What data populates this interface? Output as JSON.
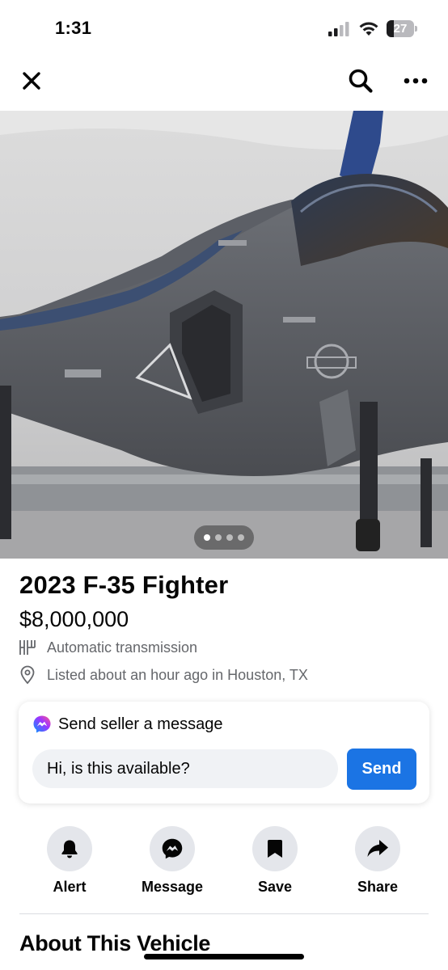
{
  "status_bar": {
    "time": "1:31",
    "battery_level": "27"
  },
  "nav": {
    "close_icon": "close-icon",
    "search_icon": "search-icon",
    "more_icon": "more-icon"
  },
  "photo": {
    "subject": "fighter jet photo",
    "page_count": 4,
    "current_page": 1
  },
  "listing": {
    "title": "2023 F-35 Fighter",
    "price": "$8,000,000",
    "transmission": "Automatic transmission",
    "listed": "Listed about an hour ago in Houston, TX"
  },
  "message": {
    "header": "Send seller a message",
    "input_value": "Hi, is this available?",
    "send_label": "Send"
  },
  "actions": [
    {
      "label": "Alert",
      "icon": "bell-icon"
    },
    {
      "label": "Message",
      "icon": "messenger-icon"
    },
    {
      "label": "Save",
      "icon": "bookmark-icon"
    },
    {
      "label": "Share",
      "icon": "share-icon"
    }
  ],
  "section": {
    "title": "About This Vehicle"
  },
  "colors": {
    "accent": "#1b74e4",
    "secondary_text": "#65676b",
    "action_bg": "#e4e6eb"
  }
}
